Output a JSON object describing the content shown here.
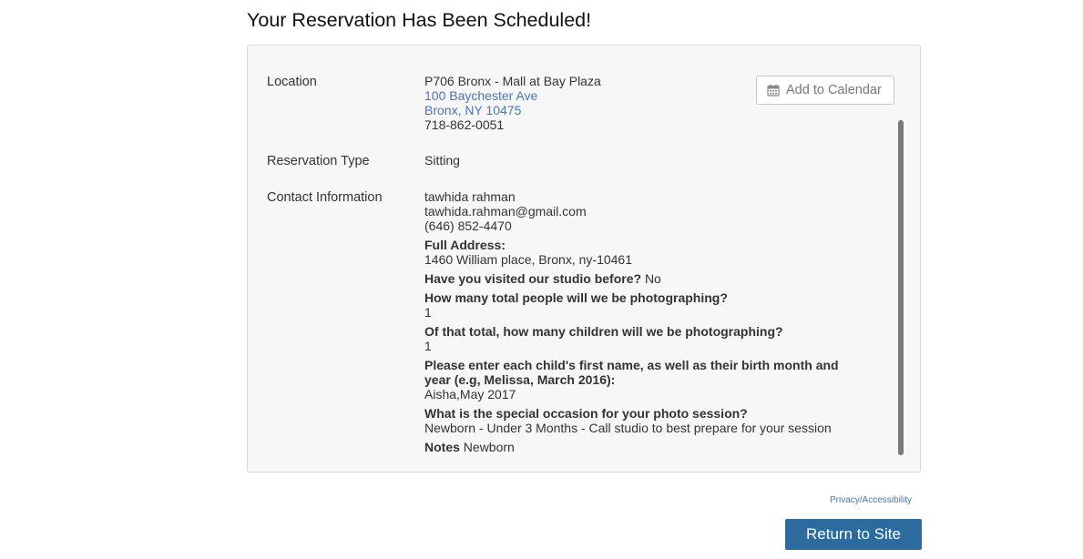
{
  "page_title": "Your Reservation Has Been Scheduled!",
  "add_to_calendar": {
    "label": "Add to Calendar",
    "icon": "calendar-icon"
  },
  "location": {
    "label": "Location",
    "name": "P706 Bronx - Mall at Bay Plaza",
    "street": "100 Baychester Ave",
    "city_state_zip": "Bronx, NY 10475",
    "phone": "718-862-0051"
  },
  "reservation_type": {
    "label": "Reservation Type",
    "value": "Sitting"
  },
  "contact": {
    "label": "Contact Information",
    "name": "tawhida rahman",
    "email": "tawhida.rahman@gmail.com",
    "phone": "(646) 852-4470",
    "full_address_label": "Full Address:",
    "full_address": "1460 William place, Bronx, ny-10461",
    "visited_q": "Have you visited our studio before?",
    "visited_a": "No",
    "people_q": "How many total people will we be photographing?",
    "people_a": "1",
    "children_q": "Of that total, how many children will we be photographing?",
    "children_a": "1",
    "child_names_q": "Please enter each child's first name, as well as their birth month and year (e.g, Melissa, March 2016):",
    "child_names_a": "Aisha,May 2017",
    "occasion_q": "What is the special occasion for your photo session?",
    "occasion_a": "Newborn - Under 3 Months - Call studio to best prepare for your session",
    "notes_label": "Notes",
    "notes_value": "Newborn"
  },
  "footer": {
    "privacy_link": "Privacy/Accessibility",
    "return_button": "Return to Site"
  },
  "colors": {
    "link": "#4a76b5",
    "primary_button": "#2d6a9e",
    "panel_bg": "#f7f7f7"
  }
}
